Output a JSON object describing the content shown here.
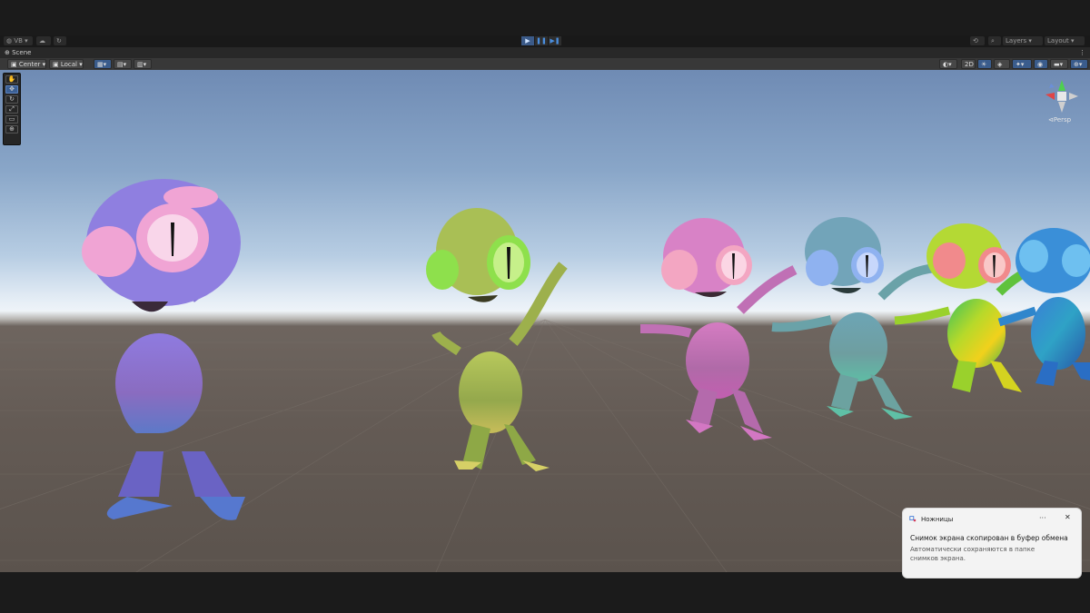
{
  "top_toolbar": {
    "account_label": "VB",
    "layers_label": "Layers",
    "layout_label": "Layout",
    "play_icon": "play-icon",
    "pause_icon": "pause-icon",
    "step_icon": "step-icon"
  },
  "scene_tab": {
    "title": "Scene"
  },
  "scene_toolbar": {
    "pivot_label": "Center",
    "space_label": "Local",
    "mode_2d_label": "2D"
  },
  "gizmo": {
    "projection_label": "Persp"
  },
  "tools": [
    "hand-icon",
    "move-icon",
    "rotate-icon",
    "scale-icon",
    "rect-icon",
    "transform-icon"
  ],
  "characters": [
    {
      "name": "purple alien",
      "color": "#8a76d0"
    },
    {
      "name": "green alien",
      "color": "#a9b85a"
    },
    {
      "name": "pink alien",
      "color": "#c877b4"
    },
    {
      "name": "teal alien",
      "color": "#6ea6a8"
    },
    {
      "name": "rainbow alien",
      "color": "#86c43e"
    },
    {
      "name": "blue alien",
      "color": "#2d82c8"
    }
  ],
  "notification": {
    "app_name": "Ножницы",
    "message": "Снимок экрана скопирован в буфер обмена",
    "details": "Автоматически сохраняются в папке снимков экрана."
  },
  "colors": {
    "accent": "#3a5c8c",
    "sky_top": "#6f8bb4",
    "ground": "#645b55"
  }
}
